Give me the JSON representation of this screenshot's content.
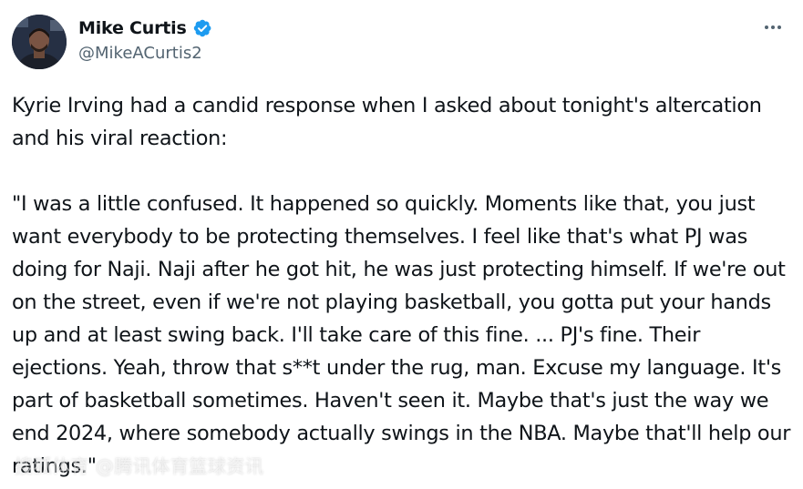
{
  "author": {
    "display_name": "Mike Curtis",
    "handle": "@MikeACurtis2",
    "verified": true,
    "verified_color": "#1d9bf0"
  },
  "tweet": {
    "paragraph_1": "Kyrie Irving had a candid response when I asked about tonight's altercation and his viral reaction:",
    "paragraph_2": "\"I was a little confused. It happened so quickly. Moments like that, you just want everybody to be protecting themselves. I feel like that's what PJ was doing for Naji. Naji after he got hit, he was just protecting himself. If we're out on the street, even if we're not playing basketball, you gotta put your hands up and at least swing back. I'll take care of this fine. ... PJ's fine. Their ejections. Yeah, throw that s**t under the rug, man. Excuse my language. It's part of basketball sometimes. Haven't seen it. Maybe that's just the way we end 2024, where somebody actually swings in the NBA. Maybe that'll help our ratings.\""
  },
  "watermark": {
    "text": "搜狐体育 @腾讯体育篮球资讯"
  },
  "icons": {
    "more": "more-horizontal-icon",
    "verified": "verified-badge-icon"
  },
  "colors": {
    "text_primary": "#0f1419",
    "text_secondary": "#536471",
    "background": "#ffffff"
  }
}
